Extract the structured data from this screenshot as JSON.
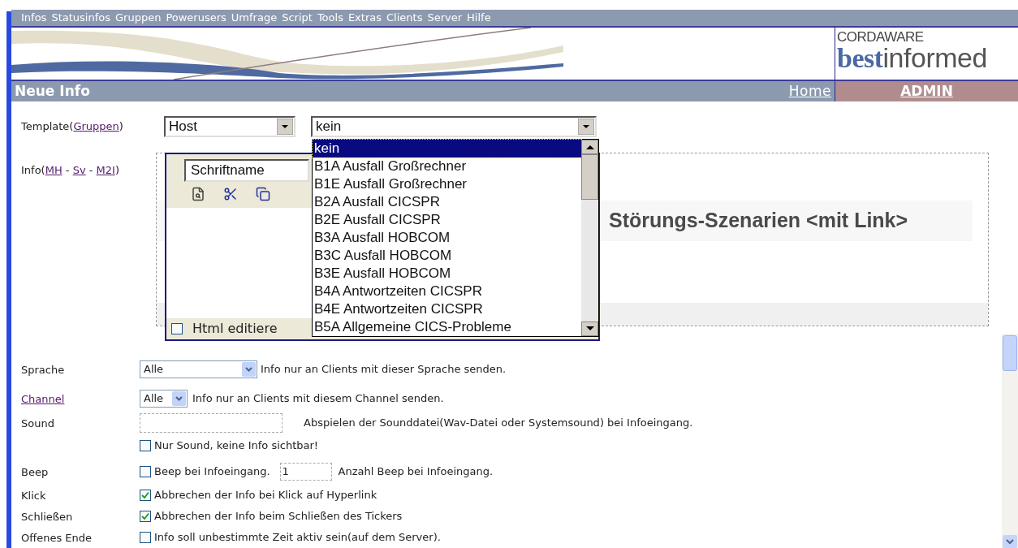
{
  "menu": [
    "Infos",
    "Statusinfos",
    "Gruppen",
    "Powerusers",
    "Umfrage",
    "Script",
    "Tools",
    "Extras",
    "Clients",
    "Server",
    "Hilfe"
  ],
  "logo": {
    "brand": "CORDAWARE",
    "wordmark_accent": "best",
    "wordmark_rest": "informed"
  },
  "nav": {
    "title": "Neue Info",
    "home": "Home",
    "admin": "ADMIN"
  },
  "template": {
    "parts": [
      {
        "kind": "text",
        "text": "Template("
      },
      {
        "kind": "link",
        "text": "Gruppen"
      },
      {
        "kind": "text",
        "text": ")"
      }
    ],
    "group_select": "Host",
    "template_select": "kein",
    "options": [
      {
        "label": "kein",
        "selected": true
      },
      {
        "label": "B1A Ausfall Großrechner",
        "selected": false
      },
      {
        "label": "B1E Ausfall Großrechner",
        "selected": false
      },
      {
        "label": "B2A Ausfall CICSPR",
        "selected": false
      },
      {
        "label": "B2E Ausfall CICSPR",
        "selected": false
      },
      {
        "label": "B3A Ausfall HOBCOM",
        "selected": false
      },
      {
        "label": "B3C Ausfall HOBCOM",
        "selected": false
      },
      {
        "label": "B3E Ausfall HOBCOM",
        "selected": false
      },
      {
        "label": "B4A Antwortzeiten CICSPR",
        "selected": false
      },
      {
        "label": "B4E Antwortzeiten CICSPR",
        "selected": false
      },
      {
        "label": "B5A Allgemeine CICS-Probleme",
        "selected": false
      }
    ]
  },
  "info": {
    "parts": [
      {
        "kind": "text",
        "text": "Info("
      },
      {
        "kind": "link",
        "text": "MH"
      },
      {
        "kind": "text",
        "text": " - "
      },
      {
        "kind": "link",
        "text": "Sv"
      },
      {
        "kind": "text",
        "text": " - "
      },
      {
        "kind": "link",
        "text": "M2I"
      },
      {
        "kind": "text",
        "text": ")"
      }
    ],
    "font_select": "Schriftname",
    "html_edit": {
      "label": "Html editiere",
      "checked": false
    },
    "preview_heading": "Störungs-Szenarien <mit Link>"
  },
  "settings": [
    {
      "label": "Sprache",
      "link": false,
      "kind": "select",
      "value": "Alle",
      "hint": "Info nur an Clients mit dieser Sprache senden."
    },
    {
      "label": "Channel",
      "link": true,
      "kind": "select_small",
      "value": "Alle",
      "hint": "Info nur an Clients mit diesem Channel senden."
    },
    {
      "label": "Sound",
      "link": false,
      "kind": "input",
      "hint": "Abspielen der Sounddatei(Wav-Datei oder Systemsound) bei Infoeingang."
    },
    {
      "kind": "checkbox",
      "checked": false,
      "text": "Nur Sound, keine Info sichtbar!"
    },
    {
      "label": "Beep",
      "link": false,
      "kind": "checkbox_input",
      "checked": false,
      "text": "Beep bei Infoeingang.",
      "value": "1",
      "hint": "Anzahl Beep bei Infoeingang."
    },
    {
      "label": "Klick",
      "link": false,
      "kind": "checkbox",
      "checked": true,
      "text": "Abbrechen der Info bei Klick auf Hyperlink"
    },
    {
      "label": "Schließen",
      "link": false,
      "kind": "checkbox",
      "checked": true,
      "text": "Abbrechen der Info beim Schließen des Tickers"
    },
    {
      "label": "Offenes Ende",
      "link": false,
      "kind": "checkbox",
      "checked": false,
      "text": "Info soll unbestimmte Zeit aktiv sein(auf dem Server)."
    }
  ]
}
